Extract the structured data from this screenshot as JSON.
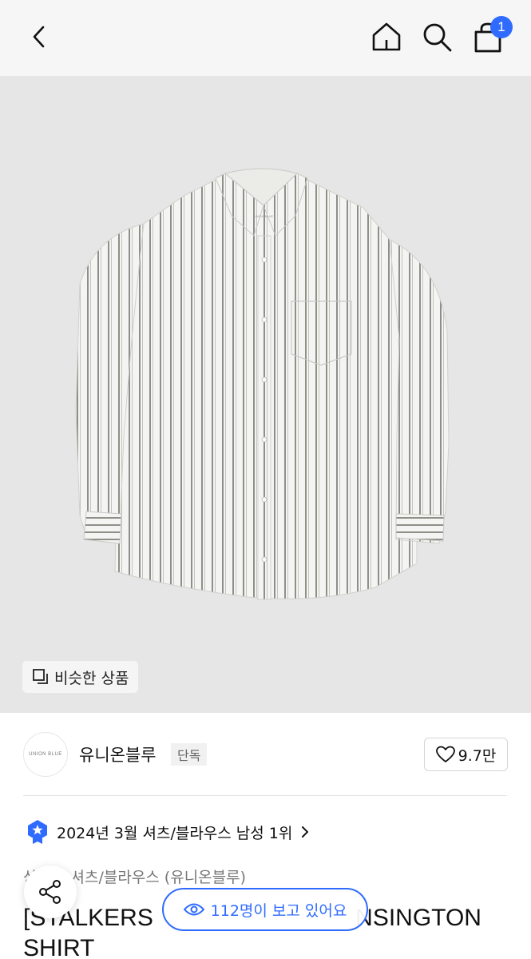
{
  "header": {
    "cart_count": "1"
  },
  "hero": {
    "similar_label": "비슷한 상품",
    "shirt_label_text": "UNION BLUE"
  },
  "brand": {
    "logo_text": "UNION BLUE",
    "name": "유니온블루",
    "tag": "단독",
    "likes": "9.7만"
  },
  "ranking": {
    "text": "2024년 3월 셔츠/블라우스 남성 1위"
  },
  "product": {
    "category_prefix": "상",
    "category_rest": "셔츠/블라우스 (유니온블루)",
    "title_left": "[STALKERS ",
    "title_right": "NSINGTON",
    "title_second_line": "SHIRT"
  },
  "viewers": {
    "text": "112명이 보고 있어요"
  },
  "colors": {
    "accent": "#2f6bff",
    "hero_bg": "#e6e6e6"
  }
}
